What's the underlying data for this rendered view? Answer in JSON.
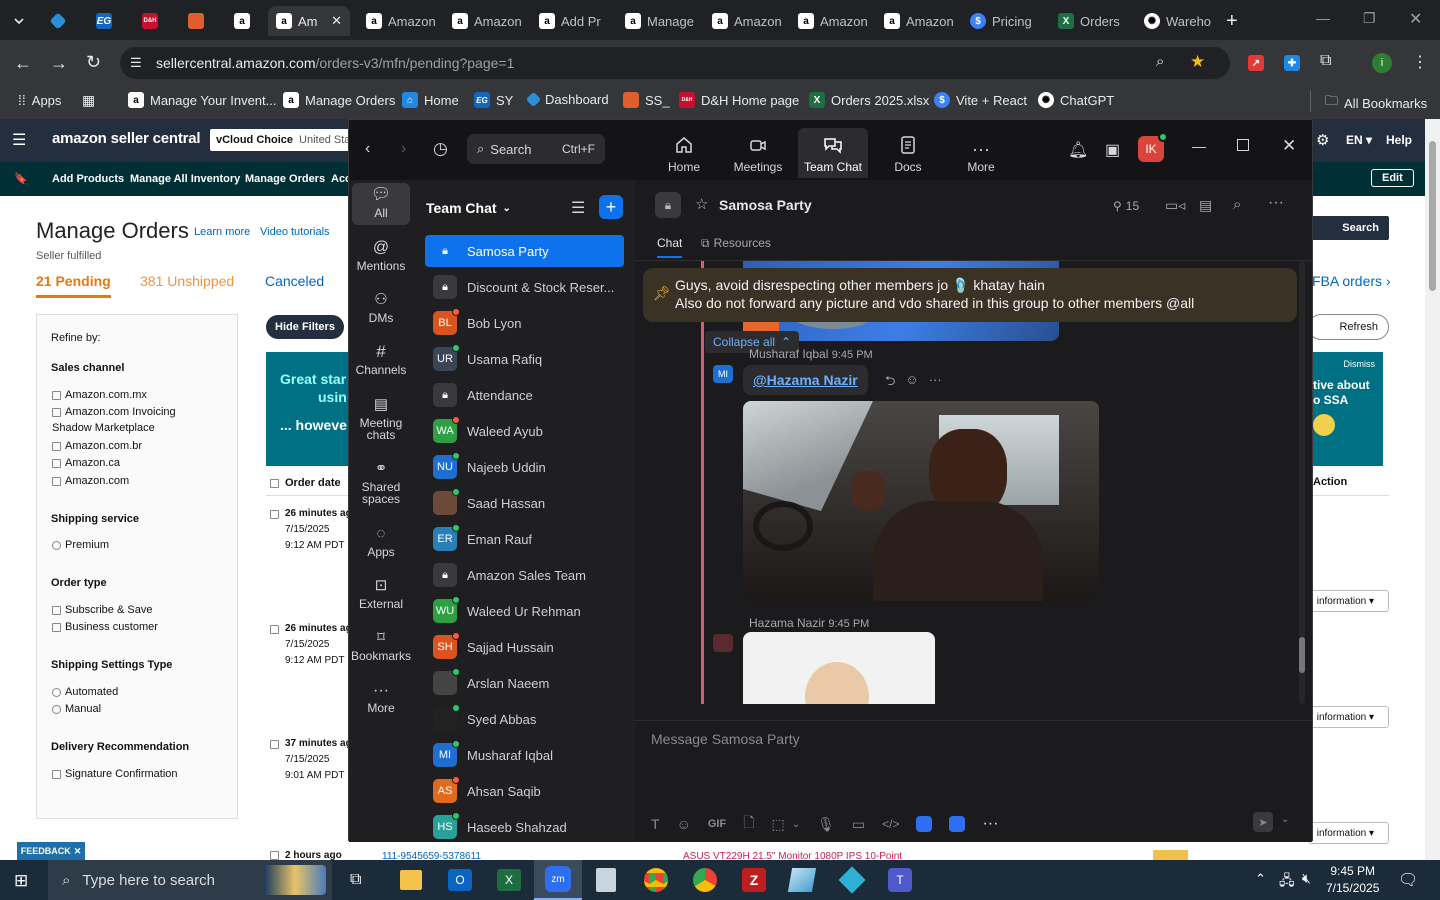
{
  "browser": {
    "tabs": [
      {
        "label": "",
        "icon": "chevron-down-icon"
      },
      {
        "label": "",
        "icon": "helium-icon",
        "color": "#2b8fd8"
      },
      {
        "label": "EG",
        "color": "#1565c0"
      },
      {
        "label": "D&H",
        "color": "#c8102e"
      },
      {
        "label": "",
        "icon": "extension-box-icon",
        "color": "#e05d2e"
      },
      {
        "label": "",
        "icon": "amazon-icon",
        "color": "#ffffff"
      },
      {
        "label": "Am",
        "icon": "amazon-icon",
        "color": "#ffffff",
        "active": true
      },
      {
        "label": "Amazon",
        "icon": "amazon-icon",
        "color": "#ffffff"
      },
      {
        "label": "Amazon",
        "icon": "amazon-icon",
        "color": "#ffffff"
      },
      {
        "label": "Add Pr",
        "icon": "amazon-icon",
        "color": "#ffffff"
      },
      {
        "label": "Manage",
        "icon": "amazon-icon",
        "color": "#ffffff"
      },
      {
        "label": "Amazon",
        "icon": "amazon-icon",
        "color": "#ffffff"
      },
      {
        "label": "Amazon",
        "icon": "amazon-icon",
        "color": "#ffffff"
      },
      {
        "label": "Amazon",
        "icon": "amazon-icon",
        "color": "#ffffff"
      },
      {
        "label": "Pricing",
        "icon": "dollar-icon",
        "color": "#3b82f6"
      },
      {
        "label": "Orders",
        "icon": "excel-icon",
        "color": "#1d6f42"
      },
      {
        "label": "Wareho",
        "icon": "openai-icon",
        "color": "#ffffff"
      }
    ],
    "url_host": "sellercentral.amazon.com",
    "url_path": "/orders-v3/mfn/pending?page=1",
    "bookmarks": [
      {
        "label": "Apps",
        "icon": "apps-grid-icon"
      },
      {
        "label": "",
        "icon": "grid-icon"
      },
      {
        "label": "Manage Your Invent...",
        "icon": "amazon-icon"
      },
      {
        "label": "Manage Orders",
        "icon": "amazon-icon"
      },
      {
        "label": "Home",
        "icon": "home-icon"
      },
      {
        "label": "SY",
        "icon": "eg-icon"
      },
      {
        "label": "Dashboard",
        "icon": "helium-icon"
      },
      {
        "label": "SS_",
        "icon": "extension-box-icon"
      },
      {
        "label": "D&H Home page",
        "icon": "dh-icon"
      },
      {
        "label": "Orders 2025.xlsx",
        "icon": "excel-icon"
      },
      {
        "label": "Vite + React",
        "icon": "dollar-icon"
      },
      {
        "label": "ChatGPT",
        "icon": "openai-icon"
      }
    ],
    "all_bookmarks": "All Bookmarks"
  },
  "amazon": {
    "logo": "amazon seller central",
    "account_store": "vCloud Choice",
    "account_region": "United Sta",
    "lang": "EN",
    "help": "Help",
    "nav": [
      "Add Products",
      "Manage All Inventory",
      "Manage Orders",
      "Acc"
    ],
    "edit": "Edit",
    "page_title": "Manage Orders",
    "learn_more": "Learn more",
    "video_tutorials": "Video tutorials",
    "seller_fulfilled": "Seller fulfilled",
    "tabs": {
      "pending": "21 Pending",
      "unshipped": "381 Unshipped",
      "canceled": "Canceled",
      "fba": "FBA orders"
    },
    "search": "Search",
    "hide_filters": "Hide Filters",
    "refresh": "Refresh",
    "refine_by": "Refine by:",
    "filters": {
      "sales_channel": "Sales channel",
      "sales_channel_items": [
        "Amazon.com.mx",
        "Amazon.com Invoicing",
        "Shadow Marketplace",
        "Amazon.com.br",
        "Amazon.ca",
        "Amazon.com"
      ],
      "shipping_service": "Shipping service",
      "shipping_service_items": [
        "Premium"
      ],
      "order_type": "Order type",
      "order_type_items": [
        "Subscribe & Save",
        "Business customer"
      ],
      "shipping_settings": "Shipping Settings Type",
      "shipping_settings_items": [
        "Automated",
        "Manual"
      ],
      "delivery": "Delivery Recommendation",
      "delivery_items": [
        "Signature Confirmation"
      ]
    },
    "banner_left_line1": "Great star",
    "banner_left_line2": "usin",
    "banner_left_line3": "... howeve",
    "banner_right_dismiss": "Dismiss",
    "banner_right_line1": "tive about",
    "banner_right_line2": "o SSA",
    "order_date_header": "Order date",
    "action_header": "Action",
    "orders": [
      {
        "age": "26 minutes ag",
        "date": "7/15/2025",
        "time": "9:12 AM PDT"
      },
      {
        "age": "26 minutes ag",
        "date": "7/15/2025",
        "time": "9:12 AM PDT"
      },
      {
        "age": "37 minutes ag",
        "date": "7/15/2025",
        "time": "9:01 AM PDT"
      },
      {
        "age": "2 hours ago",
        "date": "",
        "time": ""
      }
    ],
    "more_info": "information",
    "order_id_partial": "111-9545659-5378611",
    "product_partial": "ASUS VT229H 21.5\" Monitor 1080P IPS 10-Point",
    "feedback": "FEEDBACK"
  },
  "zoom": {
    "search_label": "Search",
    "search_shortcut": "Ctrl+F",
    "nav": [
      {
        "label": "Home",
        "icon": "home-icon"
      },
      {
        "label": "Meetings",
        "icon": "video-camera-icon"
      },
      {
        "label": "Team Chat",
        "icon": "chat-bubbles-icon",
        "active": true
      },
      {
        "label": "Docs",
        "icon": "document-icon"
      },
      {
        "label": "More",
        "icon": "more-dots-icon"
      }
    ],
    "profile_initials": "IK",
    "rail": [
      {
        "label": "All",
        "icon": "chat-icon",
        "active": true
      },
      {
        "label": "Mentions",
        "icon": "at-icon"
      },
      {
        "label": "DMs",
        "icon": "people-icon"
      },
      {
        "label": "Channels",
        "icon": "hash-icon"
      },
      {
        "label": "Meeting chats",
        "icon": "calendar-icon"
      },
      {
        "label": "Shared spaces",
        "icon": "shared-icon"
      },
      {
        "label": "Apps",
        "icon": "apps-icon"
      },
      {
        "label": "External",
        "icon": "external-icon"
      },
      {
        "label": "Bookmarks",
        "icon": "bookmark-icon"
      },
      {
        "label": "More",
        "icon": "more-dots-icon"
      }
    ],
    "list_title": "Team Chat",
    "chats": [
      {
        "name": "Samosa Party",
        "type": "lock",
        "active": true
      },
      {
        "name": "Discount & Stock Reser...",
        "type": "lock"
      },
      {
        "name": "Bob Lyon",
        "initials": "BL",
        "color": "#d9541e",
        "status": "#ff5a3c"
      },
      {
        "name": "Usama Rafiq",
        "initials": "UR",
        "color": "#3a4658",
        "status": "#2ec86a"
      },
      {
        "name": "Attendance",
        "type": "lock"
      },
      {
        "name": "Waleed Ayub",
        "initials": "WA",
        "color": "#2ea043",
        "status": "#ff5a3c"
      },
      {
        "name": "Najeeb Uddin",
        "initials": "NU",
        "color": "#1f6fd1",
        "status": "#2ec86a"
      },
      {
        "name": "Saad Hassan",
        "initials": "",
        "color": "#6b4a3a",
        "status": "#2ec86a"
      },
      {
        "name": "Eman Rauf",
        "initials": "ER",
        "color": "#2a7fb8",
        "status": "#2ec86a"
      },
      {
        "name": "Amazon Sales Team",
        "type": "lock"
      },
      {
        "name": "Waleed Ur Rehman",
        "initials": "WU",
        "color": "#2ea043",
        "status": "#2ec86a"
      },
      {
        "name": "Sajjad Hussain",
        "initials": "SH",
        "color": "#d9541e",
        "status": "#ff5a3c"
      },
      {
        "name": "Arslan Naeem",
        "initials": "",
        "color": "#444444",
        "status": "#2ec86a"
      },
      {
        "name": "Syed Abbas",
        "initials": "",
        "color": "#222222",
        "status": "#2ec86a"
      },
      {
        "name": "Musharaf Iqbal",
        "initials": "MI",
        "color": "#1f6fd1",
        "status": "#2ec86a"
      },
      {
        "name": "Ahsan Saqib",
        "initials": "AS",
        "color": "#e06a1e",
        "status": "#ff5a3c"
      },
      {
        "name": "Haseeb Shahzad",
        "initials": "HS",
        "color": "#2aa198",
        "status": "#2ec86a"
      }
    ],
    "channel": {
      "name": "Samosa Party",
      "members": "15",
      "tab_chat": "Chat",
      "tab_resources": "Resources",
      "pinned_line1": "Guys, avoid disrespecting other members jo 🩴 khatay hain",
      "pinned_line2": "Also do not forward any picture and vdo shared in this group to other members @all",
      "collapse_all": "Collapse all",
      "messages": [
        {
          "sender": "Musharaf Iqbal",
          "time": "9:45 PM",
          "initials": "MI",
          "mention": "@Hazama Nazir"
        },
        {
          "sender": "Hazama Nazir",
          "time": "9:45 PM"
        }
      ],
      "composer_placeholder": "Message Samosa Party",
      "toolbar": [
        "text-format-icon",
        "emoji-icon",
        "gif-icon",
        "file-icon",
        "screenshot-icon",
        "chevron-down-icon",
        "mic-icon",
        "video-clip-icon",
        "code-icon",
        "zoom-app-icon",
        "zoom-app2-icon",
        "more-dots-icon"
      ],
      "gif_label": "GIF"
    }
  },
  "taskbar": {
    "search_placeholder": "Type here to search",
    "time": "9:45 PM",
    "date": "7/15/2025"
  }
}
